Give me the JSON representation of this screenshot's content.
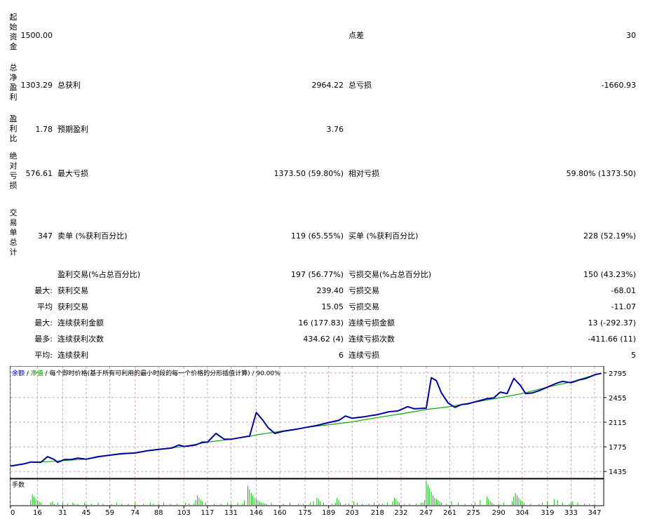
{
  "stats": {
    "initial_deposit": {
      "label": "起始资金",
      "value": "1500.00",
      "spread_label": "点差",
      "spread_value": "30"
    },
    "net_profit": {
      "label": "总净盈利",
      "value": "1303.29",
      "gross_profit_label": "总获利",
      "gross_profit_value": "2964.22",
      "gross_loss_label": "总亏损",
      "gross_loss_value": "-1660.93"
    },
    "profit_factor": {
      "label": "盈利比",
      "value": "1.78",
      "expected_label": "预期盈利",
      "expected_value": "3.76"
    },
    "abs_drawdown": {
      "label": "绝对亏损",
      "value": "576.61",
      "max_dd_label": "最大亏损",
      "max_dd_value": "1373.50 (59.80%)",
      "rel_dd_label": "相对亏损",
      "rel_dd_value": "59.80% (1373.50)"
    },
    "total_trades": {
      "label": "交易单总计",
      "value": "347",
      "short_label": "卖单 (%获利百分比)",
      "short_value": "119 (65.55%)",
      "long_label": "买单 (%获利百分比)",
      "long_value": "228 (52.19%)"
    },
    "profit_trades": {
      "label": "盈利交易(%占总百分比)",
      "value": "197 (56.77%)",
      "loss_label": "亏损交易(%占总百分比)",
      "loss_value": "150 (43.23%)"
    },
    "largest": {
      "prefix": "最大:",
      "profit_label": "获利交易",
      "profit_value": "239.40",
      "loss_label": "亏损交易",
      "loss_value": "-68.01"
    },
    "average": {
      "prefix": "平均",
      "profit_label": "获利交易",
      "profit_value": "15.05",
      "loss_label": "亏损交易",
      "loss_value": "-11.07"
    },
    "max_consec": {
      "prefix": "最大:",
      "profit_label": "连续获利金额",
      "profit_value": "16 (177.83)",
      "loss_label": "连续亏损金额",
      "loss_value": "13 (-292.37)"
    },
    "max_consec2": {
      "prefix": "最多:",
      "profit_label": "连续获利次数",
      "profit_value": "434.62 (4)",
      "loss_label": "连续亏损次数",
      "loss_value": "-411.66 (11)"
    },
    "avg_consec": {
      "prefix": "平均:",
      "profit_label": "连续获利",
      "profit_value": "6",
      "loss_label": "连续亏损",
      "loss_value": "5"
    }
  },
  "chart_legend": {
    "balance": "余额",
    "sep1": " / ",
    "equity": "净值",
    "sep2": " / ",
    "description": "每个即时价格(基于所有可利用的最小时段的每一个价格的分形插值计算)",
    "sep3": " / ",
    "quality": "90.00%"
  },
  "volume_label": "手数",
  "colors": {
    "balance": "#0000a0",
    "equity": "#00b000",
    "volume": "#00c000",
    "grid": "#d8a0a8",
    "legend_balance": "#0000c0",
    "legend_equity": "#00a000"
  },
  "chart_data": {
    "type": "line",
    "xlabel": "",
    "ylabel": "",
    "x_ticks": [
      0,
      16,
      31,
      45,
      59,
      74,
      88,
      103,
      117,
      131,
      146,
      160,
      175,
      189,
      203,
      218,
      232,
      247,
      261,
      275,
      290,
      304,
      319,
      333,
      347
    ],
    "y_ticks": [
      1435,
      1775,
      2115,
      2455,
      2795
    ],
    "xlim": [
      0,
      352
    ],
    "ylim": [
      1350,
      2880
    ],
    "series": [
      {
        "name": "余额",
        "x": [
          0,
          8,
          12,
          18,
          22,
          26,
          28,
          32,
          36,
          40,
          45,
          52,
          59,
          66,
          74,
          81,
          88,
          96,
          100,
          103,
          110,
          114,
          117,
          122,
          127,
          131,
          136,
          141,
          142,
          146,
          150,
          153,
          157,
          162,
          168,
          175,
          182,
          189,
          195,
          199,
          203,
          210,
          215,
          218,
          225,
          230,
          236,
          240,
          247,
          250,
          253,
          256,
          260,
          264,
          268,
          272,
          275,
          280,
          283,
          287,
          291,
          295,
          299,
          303,
          306,
          310,
          314,
          319,
          324,
          328,
          333,
          338,
          342,
          347,
          351
        ],
        "y": [
          1510,
          1540,
          1565,
          1560,
          1640,
          1600,
          1560,
          1600,
          1600,
          1620,
          1605,
          1640,
          1660,
          1680,
          1690,
          1720,
          1740,
          1760,
          1800,
          1780,
          1800,
          1840,
          1840,
          1960,
          1880,
          1880,
          1900,
          1920,
          1920,
          2250,
          2140,
          2040,
          1960,
          1990,
          2010,
          2040,
          2070,
          2110,
          2140,
          2200,
          2170,
          2190,
          2210,
          2220,
          2260,
          2270,
          2330,
          2300,
          2310,
          2730,
          2690,
          2520,
          2380,
          2320,
          2360,
          2370,
          2390,
          2420,
          2440,
          2450,
          2530,
          2510,
          2720,
          2620,
          2510,
          2520,
          2550,
          2600,
          2650,
          2680,
          2660,
          2700,
          2720,
          2770,
          2790
        ]
      },
      {
        "name": "净值",
        "x": [
          0,
          8,
          12,
          22,
          28,
          45,
          59,
          74,
          88,
          103,
          117,
          131,
          142,
          146,
          175,
          203,
          218,
          232,
          247,
          261,
          275,
          290,
          304,
          319,
          333,
          347,
          351
        ],
        "y": [
          1510,
          1540,
          1565,
          1570,
          1580,
          1605,
          1660,
          1690,
          1740,
          1780,
          1840,
          1880,
          1920,
          1940,
          2040,
          2120,
          2180,
          2230,
          2290,
          2330,
          2390,
          2450,
          2510,
          2600,
          2670,
          2770,
          2790
        ]
      }
    ],
    "volume": {
      "name": "手数",
      "x": [
        12,
        13,
        14,
        15,
        16,
        17,
        18,
        24,
        25,
        26,
        28,
        31,
        34,
        37,
        38,
        40,
        44,
        45,
        48,
        52,
        55,
        60,
        63,
        66,
        70,
        74,
        79,
        83,
        85,
        88,
        91,
        95,
        99,
        104,
        106,
        109,
        110,
        111,
        112,
        113,
        114,
        116,
        121,
        125,
        129,
        131,
        135,
        138,
        139,
        141,
        142,
        143,
        144,
        145,
        146,
        147,
        148,
        149,
        150,
        151,
        152,
        155,
        162,
        166,
        171,
        174,
        178,
        180,
        182,
        183,
        184,
        186,
        191,
        193,
        194,
        195,
        196,
        199,
        201,
        204,
        206,
        209,
        213,
        216,
        219,
        221,
        224,
        227,
        228,
        229,
        230,
        231,
        234,
        237,
        241,
        244,
        245,
        246,
        247,
        248,
        249,
        250,
        251,
        252,
        253,
        254,
        255,
        256,
        259,
        262,
        266,
        270,
        274,
        276,
        279,
        283,
        284,
        285,
        286,
        287,
        290,
        293,
        298,
        299,
        300,
        301,
        302,
        303,
        304,
        305,
        309,
        314,
        316,
        319,
        323,
        325,
        328,
        332,
        333,
        334,
        337,
        341,
        344,
        347
      ],
      "values": [
        4,
        9,
        7,
        5,
        4,
        3,
        2,
        2,
        3,
        1,
        2,
        2,
        1,
        2,
        1,
        1,
        2,
        1,
        1,
        2,
        1,
        1,
        2,
        1,
        1,
        2,
        1,
        2,
        1,
        1,
        2,
        1,
        1,
        2,
        1,
        1,
        4,
        8,
        6,
        4,
        3,
        2,
        1,
        1,
        2,
        1,
        2,
        1,
        4,
        16,
        13,
        10,
        8,
        6,
        5,
        4,
        3,
        2,
        2,
        1,
        1,
        2,
        1,
        2,
        1,
        1,
        2,
        3,
        6,
        5,
        3,
        2,
        1,
        2,
        6,
        4,
        2,
        1,
        1,
        3,
        2,
        1,
        1,
        2,
        1,
        1,
        2,
        3,
        6,
        5,
        3,
        2,
        1,
        1,
        1,
        2,
        2,
        4,
        20,
        17,
        14,
        11,
        8,
        6,
        5,
        4,
        3,
        2,
        1,
        3,
        2,
        1,
        1,
        2,
        4,
        7,
        5,
        3,
        2,
        1,
        1,
        2,
        3,
        7,
        10,
        8,
        6,
        4,
        3,
        2,
        1,
        1,
        2,
        3,
        5,
        4,
        2,
        1,
        2,
        3,
        2,
        1,
        1,
        1
      ]
    }
  }
}
